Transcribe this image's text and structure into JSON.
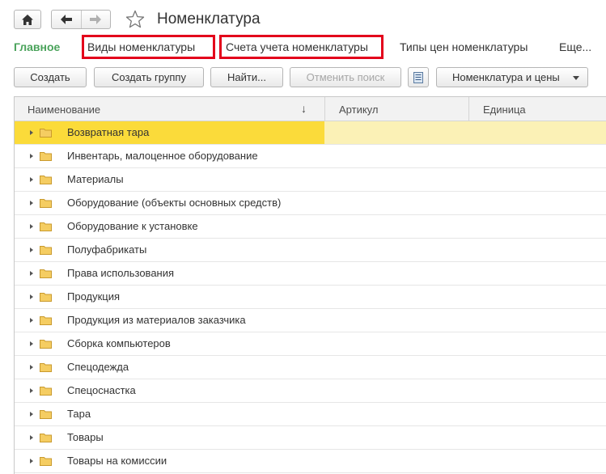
{
  "header": {
    "title": "Номенклатура",
    "home_icon": "home-icon",
    "back_icon": "arrow-left-icon",
    "forward_icon": "arrow-right-icon",
    "favorite_icon": "star-outline-icon"
  },
  "sections": {
    "main": "Главное",
    "kinds": "Виды номенклатуры",
    "accounts": "Счета учета номенклатуры",
    "price_types": "Типы цен номенклатуры",
    "more": "Еще..."
  },
  "toolbar": {
    "create": "Создать",
    "create_group": "Создать группу",
    "find": "Найти...",
    "cancel_search": "Отменить поиск",
    "list_icon": "list-icon",
    "view_mode": "Номенклатура и цены"
  },
  "table": {
    "columns": {
      "name": "Наименование",
      "article": "Артикул",
      "unit": "Единица"
    },
    "sort_indicator": "↓",
    "rows": [
      "Возвратная тара",
      "Инвентарь, малоценное оборудование",
      "Материалы",
      "Оборудование (объекты основных средств)",
      "Оборудование к установке",
      "Полуфабрикаты",
      "Права использования",
      "Продукция",
      "Продукция из материалов заказчика",
      "Сборка компьютеров",
      "Спецодежда",
      "Спецоснастка",
      "Тара",
      "Товары",
      "Товары на комиссии"
    ],
    "selected_index": 0
  },
  "colors": {
    "accent_green": "#4aa35b",
    "highlight_red": "#e3001b",
    "selected_row": "#fbdb3a",
    "folder": "#f5cd62"
  }
}
